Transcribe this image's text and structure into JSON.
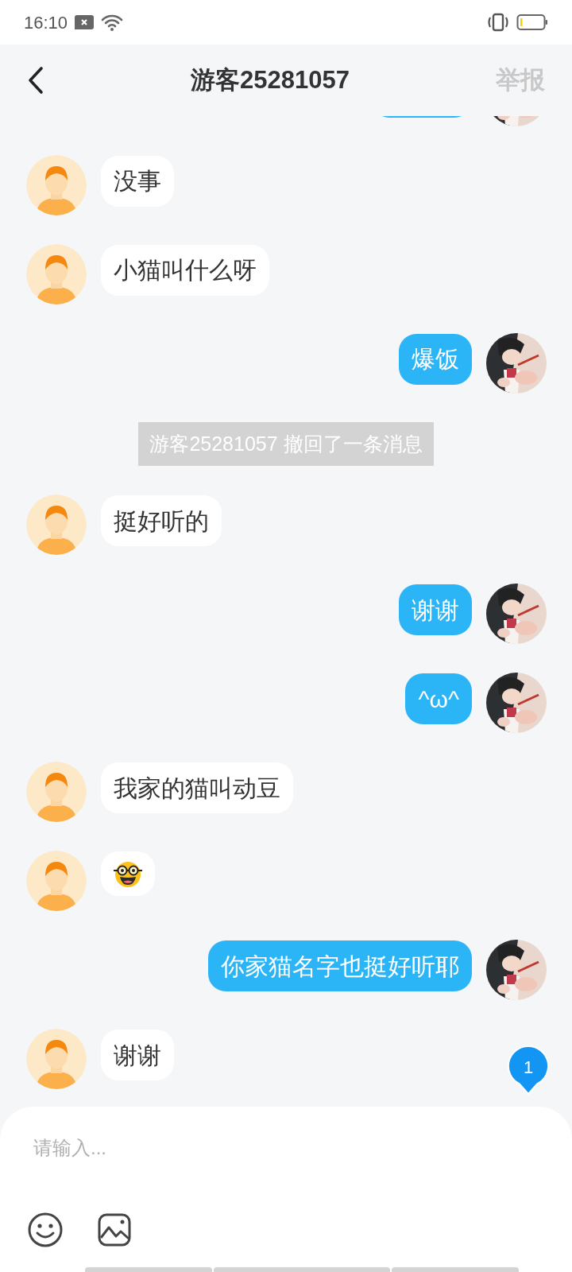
{
  "status_bar": {
    "time": "16:10"
  },
  "header": {
    "title": "游客25281057",
    "action": "举报",
    "action_disabled": true
  },
  "messages": [
    {
      "kind": "partial"
    },
    {
      "kind": "incoming",
      "text": "没事"
    },
    {
      "kind": "incoming",
      "text": "小猫叫什么呀"
    },
    {
      "kind": "outgoing",
      "text": "爆饭"
    },
    {
      "kind": "notice",
      "text": "游客25281057 撤回了一条消息"
    },
    {
      "kind": "incoming",
      "text": "挺好听的"
    },
    {
      "kind": "outgoing",
      "text": "谢谢"
    },
    {
      "kind": "outgoing",
      "text": "^ω^"
    },
    {
      "kind": "incoming",
      "text": "我家的猫叫动豆"
    },
    {
      "kind": "sticker"
    },
    {
      "kind": "outgoing",
      "text": "你家猫名字也挺好听耶"
    },
    {
      "kind": "incoming",
      "text": "谢谢"
    }
  ],
  "unread_badge": "1",
  "composer": {
    "placeholder": "请输入..."
  }
}
